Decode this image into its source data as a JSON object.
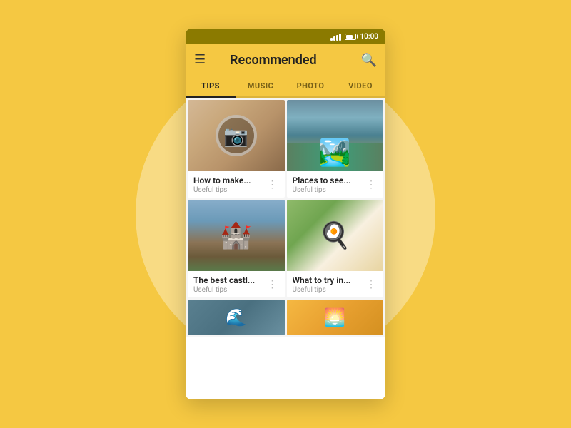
{
  "background": {
    "color": "#F5C842"
  },
  "statusBar": {
    "time": "10:00"
  },
  "header": {
    "title": "Recommended",
    "menuIcon": "☰",
    "searchIcon": "🔍"
  },
  "tabs": [
    {
      "id": "tips",
      "label": "TIPS",
      "active": true
    },
    {
      "id": "music",
      "label": "MUSIC",
      "active": false
    },
    {
      "id": "photo",
      "label": "PHOTO",
      "active": false
    },
    {
      "id": "video",
      "label": "VIDEO",
      "active": false
    }
  ],
  "cards": [
    {
      "id": "card1",
      "title": "How to make...",
      "subtitle": "Useful tips",
      "photoType": "camera"
    },
    {
      "id": "card2",
      "title": "Places to see...",
      "subtitle": "Useful tips",
      "photoType": "canyon"
    },
    {
      "id": "card3",
      "title": "The best castl...",
      "subtitle": "Useful tips",
      "photoType": "castle"
    },
    {
      "id": "card4",
      "title": "What to try in...",
      "subtitle": "Useful tips",
      "photoType": "food"
    }
  ],
  "moreIcon": "⋮"
}
